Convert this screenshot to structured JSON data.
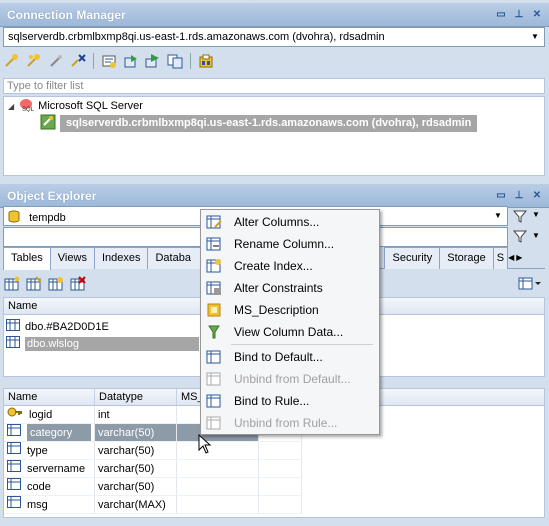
{
  "connection_manager": {
    "title": "Connection Manager",
    "connection_value": "sqlserverdb.crbmlbxmp8qi.us-east-1.rds.amazonaws.com (dvohra), rdsadmin",
    "filter_placeholder": "Type to filter list",
    "tree": {
      "root_label": "Microsoft SQL Server",
      "child_label": "sqlserverdb.crbmlbxmp8qi.us-east-1.rds.amazonaws.com (dvohra), rdsadmin"
    }
  },
  "object_explorer": {
    "title": "Object Explorer",
    "database": "tempdb",
    "second_combo": "",
    "tabs": [
      "Tables",
      "Views",
      "Indexes",
      "Databa",
      "Security",
      "Storage",
      "S"
    ],
    "tables_header": "Name",
    "tables": [
      "dbo.#BA2D0D1E",
      "dbo.wlslog"
    ],
    "columns_headers": [
      "Name",
      "Datatype",
      "MS_"
    ],
    "columns": [
      {
        "name": "logid",
        "type": "int"
      },
      {
        "name": "category",
        "type": "varchar(50)"
      },
      {
        "name": "type",
        "type": "varchar(50)"
      },
      {
        "name": "servername",
        "type": "varchar(50)"
      },
      {
        "name": "code",
        "type": "varchar(50)"
      },
      {
        "name": "msg",
        "type": "varchar(MAX)"
      }
    ]
  },
  "context_menu": {
    "items": [
      {
        "label": "Alter Columns...",
        "enabled": true
      },
      {
        "label": "Rename Column...",
        "enabled": true
      },
      {
        "label": "Create Index...",
        "enabled": true
      },
      {
        "label": "Alter Constraints",
        "enabled": true
      },
      {
        "label": "MS_Description",
        "enabled": true
      },
      {
        "label": "View Column Data...",
        "enabled": true
      },
      {
        "label": "Bind to Default...",
        "enabled": true
      },
      {
        "label": "Unbind from Default...",
        "enabled": false
      },
      {
        "label": "Bind to Rule...",
        "enabled": true
      },
      {
        "label": "Unbind from Rule...",
        "enabled": false
      }
    ]
  },
  "colors": {
    "title_bar": "#9db8da",
    "selection": "#a6a6a6",
    "menu_bg": "#f5f6f8"
  }
}
